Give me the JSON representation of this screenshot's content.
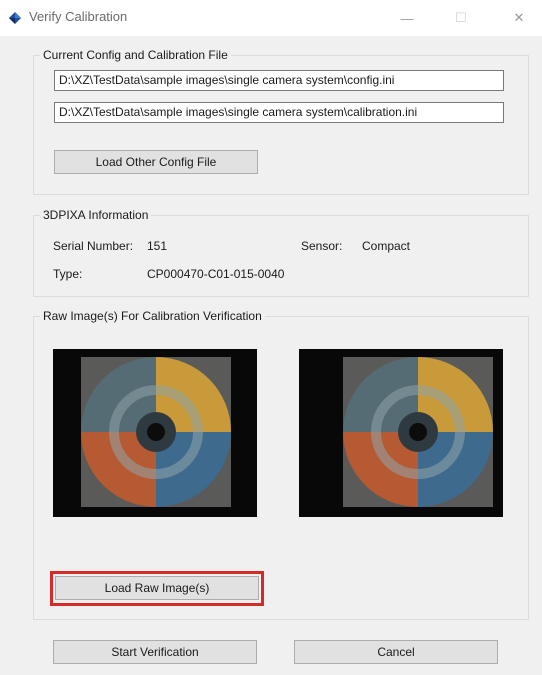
{
  "window": {
    "title": "Verify Calibration",
    "minimize_glyph": "—",
    "maximize_glyph": "☐",
    "close_glyph": "✕",
    "icon": "app-diamond-icon"
  },
  "config_group": {
    "legend": "Current Config and Calibration File",
    "config_path": "D:\\XZ\\TestData\\sample images\\single camera system\\config.ini",
    "calibration_path": "D:\\XZ\\TestData\\sample images\\single camera system\\calibration.ini",
    "load_button": "Load Other Config File"
  },
  "info_group": {
    "legend": "3DPIXA Information",
    "serial_label": "Serial Number:",
    "serial_value": "151",
    "sensor_label": "Sensor:",
    "sensor_value": "Compact",
    "type_label": "Type:",
    "type_value": "CP000470-C01-015-0040"
  },
  "raw_group": {
    "legend": "Raw Image(s) For Calibration Verification",
    "images": [
      "raw-image-left",
      "raw-image-right"
    ],
    "load_button": "Load Raw Image(s)",
    "highlight_color": "#d42a2a"
  },
  "footer": {
    "start_button": "Start Verification",
    "cancel_button": "Cancel"
  }
}
